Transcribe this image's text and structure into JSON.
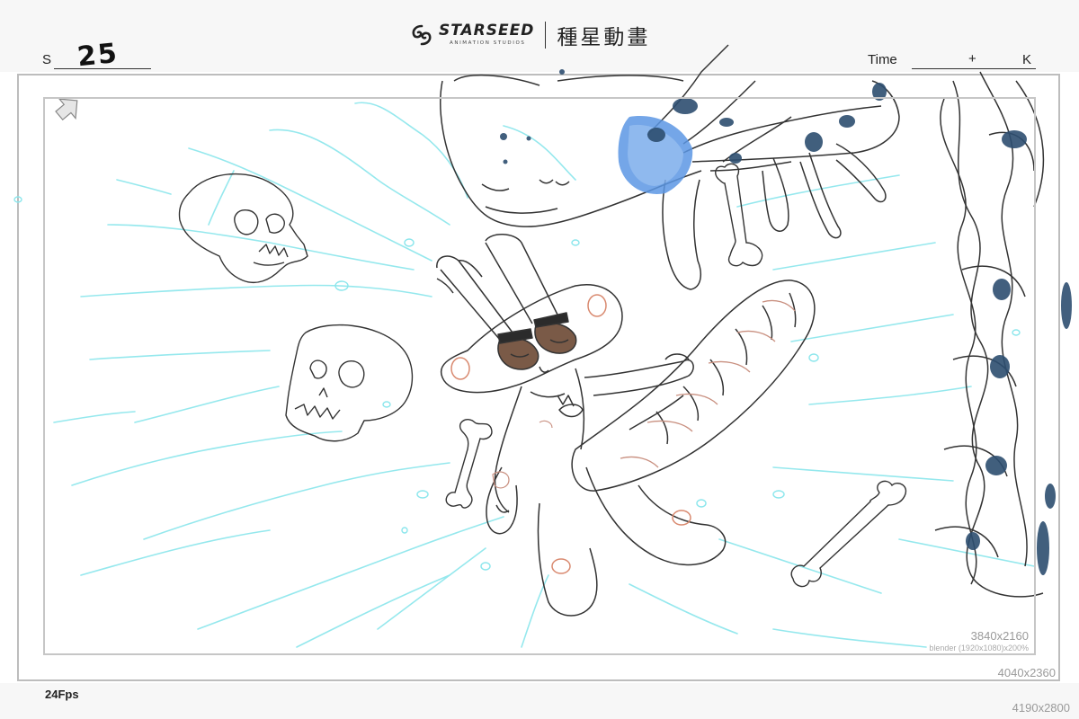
{
  "header": {
    "brand": "STARSEED",
    "brand_sub": "ANIMATION STUDIOS",
    "brand_cjk": "種星動畫"
  },
  "sheet": {
    "scene_label": "S",
    "scene_number": "25",
    "time_label": "Time",
    "time_plus": "+",
    "time_k": "K",
    "fps": "24Fps"
  },
  "resolutions": {
    "safe_frame": "3840x2160",
    "safe_note": "blender (1920x1080)x200%",
    "outer_frame": "4040x2360",
    "page": "4190x2800"
  },
  "icons": [
    "swirl-logo-icon",
    "arrow-cursor-icon"
  ],
  "colors": {
    "line_art": "#333333",
    "splash_lines": "#7fe0e8",
    "shadow_fill": "#2d4e70",
    "glow_fill": "#4f8fe0",
    "eye_fill": "#7a5a47",
    "cheek_stroke": "#d98a70",
    "frame_border": "#bdbdbd"
  }
}
